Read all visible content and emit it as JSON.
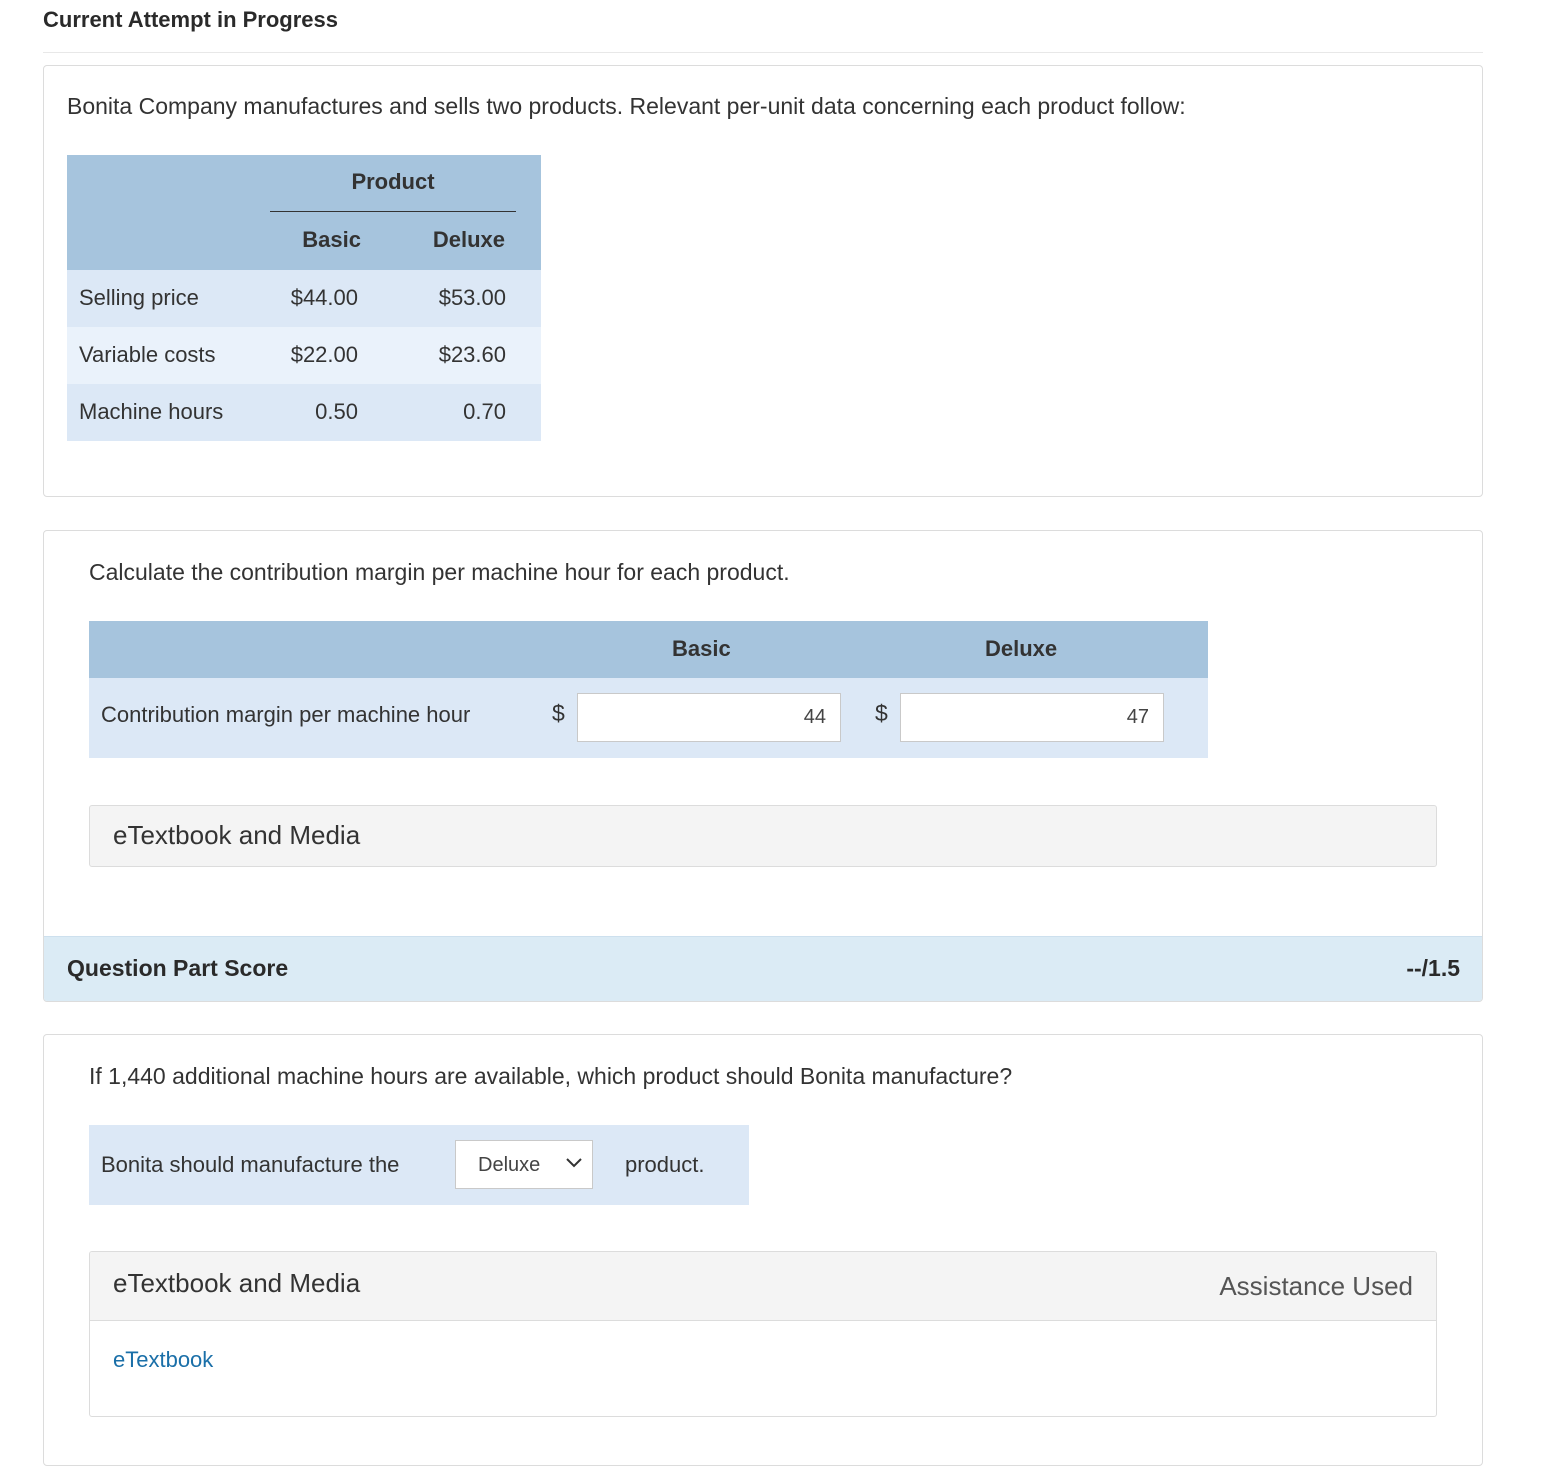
{
  "header": {
    "title": "Current Attempt in Progress"
  },
  "intro": {
    "text": "Bonita Company manufactures and sells two products. Relevant per-unit data concerning each product follow:",
    "table": {
      "group_header": "Product",
      "columns": [
        "Basic",
        "Deluxe"
      ],
      "rows": [
        {
          "label": "Selling price",
          "basic": "$44.00",
          "deluxe": "$53.00"
        },
        {
          "label": "Variable costs",
          "basic": "$22.00",
          "deluxe": "$23.60"
        },
        {
          "label": "Machine hours",
          "basic": "0.50",
          "deluxe": "0.70"
        }
      ]
    }
  },
  "part1": {
    "question": "Calculate the contribution margin per machine hour for each product.",
    "columns": [
      "Basic",
      "Deluxe"
    ],
    "row_label": "Contribution margin per machine hour",
    "currency": "$",
    "basic_value": "44",
    "deluxe_value": "47",
    "media_label": "eTextbook and Media",
    "score_label": "Question Part Score",
    "score_value": "--/1.5"
  },
  "part2": {
    "question": "If 1,440 additional machine hours are available, which product should Bonita manufacture?",
    "sentence_pre": "Bonita should manufacture the",
    "select_value": "Deluxe",
    "sentence_post": "product.",
    "media_label": "eTextbook and Media",
    "assistance_label": "Assistance Used",
    "etextbook_link": "eTextbook"
  }
}
